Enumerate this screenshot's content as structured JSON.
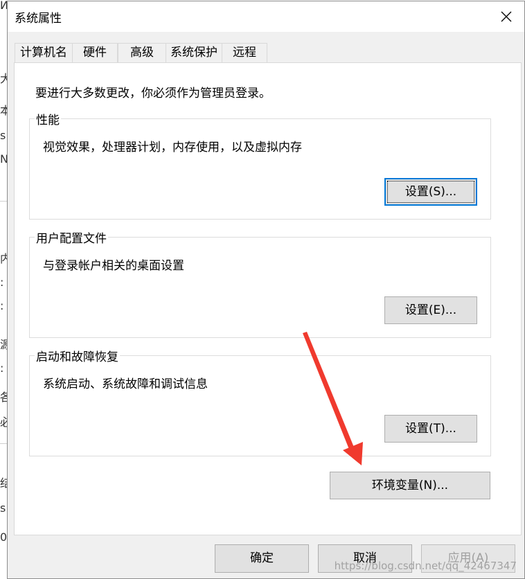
{
  "window": {
    "title": "系统属性"
  },
  "tabs": [
    {
      "label": "计算机名",
      "active": false
    },
    {
      "label": "硬件",
      "active": false
    },
    {
      "label": "高级",
      "active": true
    },
    {
      "label": "系统保护",
      "active": false
    },
    {
      "label": "远程",
      "active": false
    }
  ],
  "admin_note": "要进行大多数更改，你必须作为管理员登录。",
  "groups": {
    "performance": {
      "title": "性能",
      "description": "视觉效果，处理器计划，内存使用，以及虚拟内存",
      "button": "设置(S)..."
    },
    "user_profiles": {
      "title": "用户配置文件",
      "description": "与登录帐户相关的桌面设置",
      "button": "设置(E)..."
    },
    "startup_recovery": {
      "title": "启动和故障恢复",
      "description": "系统启动、系统故障和调试信息",
      "button": "设置(T)..."
    }
  },
  "env_button": "环境变量(N)...",
  "footer": {
    "ok": "确定",
    "cancel": "取消",
    "apply": "应用(A)"
  },
  "background_chars": [
    "И",
    "大",
    "本",
    "s",
    "N",
    "内",
    ":",
    ":",
    "源",
    ":",
    "各",
    "必",
    "结",
    "s",
    "0"
  ],
  "watermark": "https://blog.csdn.net/qq_42467347",
  "colors": {
    "focus_border": "#0078d7",
    "arrow": "#f03a2e",
    "button_bg": "#e1e1e1"
  }
}
